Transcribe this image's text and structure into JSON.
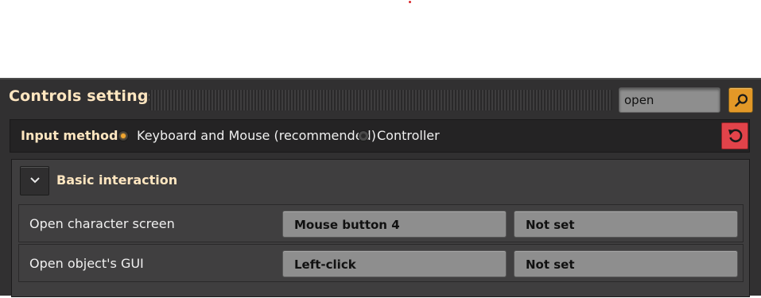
{
  "window": {
    "title": "Controls settings"
  },
  "search": {
    "value": "open"
  },
  "input_method": {
    "label": "Input method:",
    "options": [
      {
        "label": "Keyboard and Mouse (recommended)",
        "selected": true
      },
      {
        "label": "Controller",
        "selected": false
      }
    ]
  },
  "section": {
    "title": "Basic interaction",
    "rows": [
      {
        "label": "Open character screen",
        "primary": "Mouse button 4",
        "secondary": "Not set"
      },
      {
        "label": "Open object's GUI",
        "primary": "Left-click",
        "secondary": "Not set"
      }
    ]
  },
  "icons": {
    "search": "magnifier-icon",
    "reset": "reset-icon",
    "collapse": "chevron-down-icon"
  },
  "colors": {
    "accent": "#e39827",
    "reset": "#e2434a",
    "heading": "#ffe6c0"
  }
}
